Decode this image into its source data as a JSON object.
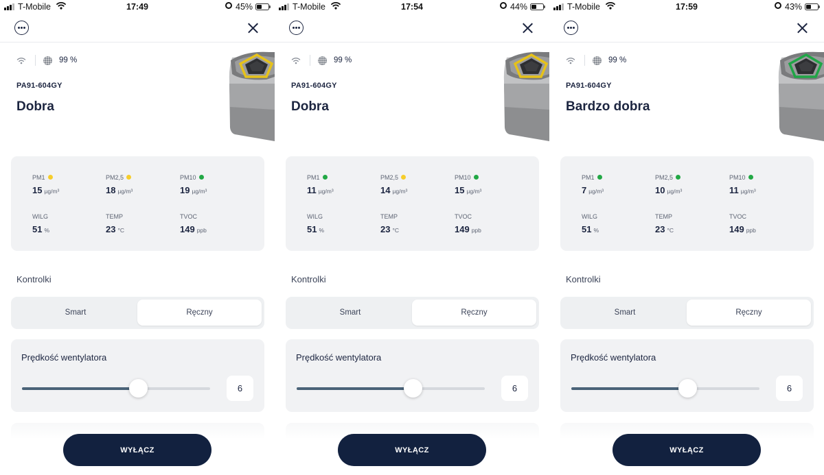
{
  "colors": {
    "dot_green": "#22a845",
    "dot_yellow": "#f6cd2b",
    "navy": "#12213f"
  },
  "screens": [
    {
      "status": {
        "carrier": "T-Mobile",
        "time": "17:49",
        "battery": "45%",
        "battery_level": 0.45
      },
      "device": {
        "filter": "99 %",
        "model": "PA91-604GY",
        "quality": "Dobra",
        "ring_color": "#e6c21a"
      },
      "readings": [
        {
          "label": "PM1",
          "value": "15",
          "unit": "µg/m³",
          "dot": "#f6cd2b"
        },
        {
          "label": "PM2,5",
          "value": "18",
          "unit": "µg/m³",
          "dot": "#f6cd2b"
        },
        {
          "label": "PM10",
          "value": "19",
          "unit": "µg/m³",
          "dot": "#22a845"
        },
        {
          "label": "WILG",
          "value": "51",
          "unit": "%"
        },
        {
          "label": "TEMP",
          "value": "23",
          "unit": "°C"
        },
        {
          "label": "TVOC",
          "value": "149",
          "unit": "ppb"
        }
      ],
      "controls": {
        "title": "Kontrolki",
        "smart": "Smart",
        "manual": "Ręczny"
      },
      "fan": {
        "title": "Prędkość wentylatora",
        "value": "6",
        "level": 0.62
      },
      "power": {
        "label": "WYŁĄCZ"
      }
    },
    {
      "status": {
        "carrier": "T-Mobile",
        "time": "17:54",
        "battery": "44%",
        "battery_level": 0.44
      },
      "device": {
        "filter": "99 %",
        "model": "PA91-604GY",
        "quality": "Dobra",
        "ring_color": "#e6c21a"
      },
      "readings": [
        {
          "label": "PM1",
          "value": "11",
          "unit": "µg/m³",
          "dot": "#22a845"
        },
        {
          "label": "PM2,5",
          "value": "14",
          "unit": "µg/m³",
          "dot": "#f6cd2b"
        },
        {
          "label": "PM10",
          "value": "15",
          "unit": "µg/m³",
          "dot": "#22a845"
        },
        {
          "label": "WILG",
          "value": "51",
          "unit": "%"
        },
        {
          "label": "TEMP",
          "value": "23",
          "unit": "°C"
        },
        {
          "label": "TVOC",
          "value": "149",
          "unit": "ppb"
        }
      ],
      "controls": {
        "title": "Kontrolki",
        "smart": "Smart",
        "manual": "Ręczny"
      },
      "fan": {
        "title": "Prędkość wentylatora",
        "value": "6",
        "level": 0.62
      },
      "power": {
        "label": "WYŁĄCZ"
      }
    },
    {
      "status": {
        "carrier": "T-Mobile",
        "time": "17:59",
        "battery": "43%",
        "battery_level": 0.43
      },
      "device": {
        "filter": "99 %",
        "model": "PA91-604GY",
        "quality": "Bardzo dobra",
        "ring_color": "#1fa646"
      },
      "readings": [
        {
          "label": "PM1",
          "value": "7",
          "unit": "µg/m³",
          "dot": "#22a845"
        },
        {
          "label": "PM2,5",
          "value": "10",
          "unit": "µg/m³",
          "dot": "#22a845"
        },
        {
          "label": "PM10",
          "value": "11",
          "unit": "µg/m³",
          "dot": "#22a845"
        },
        {
          "label": "WILG",
          "value": "51",
          "unit": "%"
        },
        {
          "label": "TEMP",
          "value": "23",
          "unit": "°C"
        },
        {
          "label": "TVOC",
          "value": "149",
          "unit": "ppb"
        }
      ],
      "controls": {
        "title": "Kontrolki",
        "smart": "Smart",
        "manual": "Ręczny"
      },
      "fan": {
        "title": "Prędkość wentylatora",
        "value": "6",
        "level": 0.62
      },
      "power": {
        "label": "WYŁĄCZ"
      }
    }
  ]
}
